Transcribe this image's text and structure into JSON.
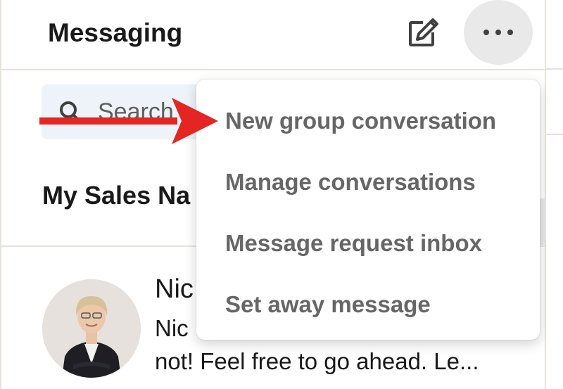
{
  "header": {
    "title": "Messaging",
    "compose_icon": "compose-icon",
    "more_icon": "more-horizontal-icon"
  },
  "search": {
    "placeholder": "Search",
    "icon": "search-icon"
  },
  "section": {
    "label": "My Sales Na"
  },
  "conversation": {
    "name": "Nic",
    "preview_line1": "Nic",
    "preview_line2": "not! Feel free to go ahead. Le..."
  },
  "dropdown": {
    "items": [
      {
        "label": "New group conversation"
      },
      {
        "label": "Manage conversations"
      },
      {
        "label": "Message request inbox"
      },
      {
        "label": "Set away message"
      }
    ]
  },
  "annotation": {
    "arrow_color": "#e52521",
    "arrow_icon": "red-arrow-pointer"
  },
  "colors": {
    "menu_text": "#666666",
    "title_text": "#191919",
    "search_bg": "#edf3f8"
  }
}
